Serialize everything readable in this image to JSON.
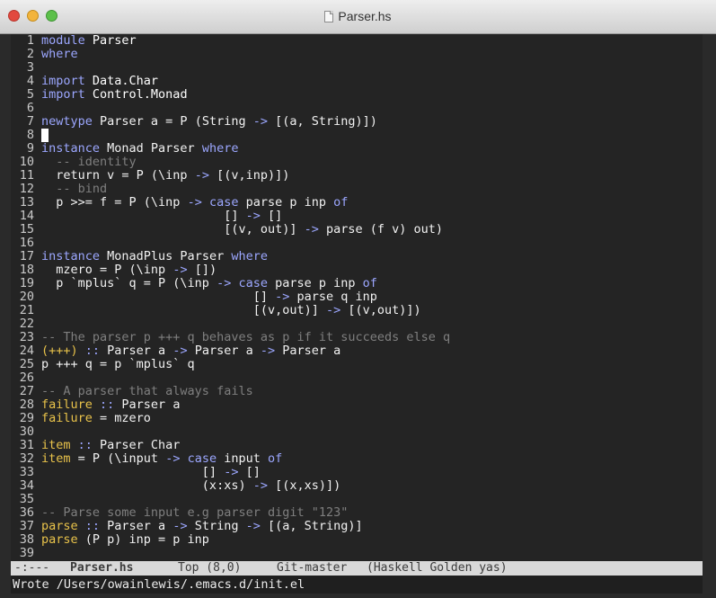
{
  "window": {
    "title": "Parser.hs",
    "file_icon": "document-icon",
    "controls": [
      "close-button",
      "minimize-button",
      "zoom-button"
    ]
  },
  "editor": {
    "lines": [
      {
        "n": "1",
        "segs": [
          {
            "t": "module ",
            "c": "kw"
          },
          {
            "t": "Parser",
            "c": "ty"
          }
        ]
      },
      {
        "n": "2",
        "segs": [
          {
            "t": "where",
            "c": "kw"
          }
        ]
      },
      {
        "n": "3",
        "segs": []
      },
      {
        "n": "4",
        "segs": [
          {
            "t": "import ",
            "c": "kw"
          },
          {
            "t": "Data.Char",
            "c": "ty"
          }
        ]
      },
      {
        "n": "5",
        "segs": [
          {
            "t": "import ",
            "c": "kw"
          },
          {
            "t": "Control.Monad",
            "c": "ty"
          }
        ]
      },
      {
        "n": "6",
        "segs": []
      },
      {
        "n": "7",
        "segs": [
          {
            "t": "newtype ",
            "c": "kw"
          },
          {
            "t": "Parser a = P (String ",
            "c": ""
          },
          {
            "t": "->",
            "c": "kw"
          },
          {
            "t": " [(a, String)])",
            "c": ""
          }
        ]
      },
      {
        "n": "8",
        "segs": [],
        "cursor": true
      },
      {
        "n": "9",
        "segs": [
          {
            "t": "instance ",
            "c": "kw"
          },
          {
            "t": "Monad Parser ",
            "c": ""
          },
          {
            "t": "where",
            "c": "kw"
          }
        ]
      },
      {
        "n": "10",
        "segs": [
          {
            "t": "  -- identity",
            "c": "cm"
          }
        ]
      },
      {
        "n": "11",
        "segs": [
          {
            "t": "  return v = P (\\inp ",
            "c": ""
          },
          {
            "t": "->",
            "c": "kw"
          },
          {
            "t": " [(v,inp)])",
            "c": ""
          }
        ]
      },
      {
        "n": "12",
        "segs": [
          {
            "t": "  -- bind",
            "c": "cm"
          }
        ]
      },
      {
        "n": "13",
        "segs": [
          {
            "t": "  p >>= f = P (\\inp ",
            "c": ""
          },
          {
            "t": "->",
            "c": "kw"
          },
          {
            "t": " ",
            "c": ""
          },
          {
            "t": "case",
            "c": "kw"
          },
          {
            "t": " parse p inp ",
            "c": ""
          },
          {
            "t": "of",
            "c": "kw"
          }
        ]
      },
      {
        "n": "14",
        "segs": [
          {
            "t": "                         [] ",
            "c": ""
          },
          {
            "t": "->",
            "c": "kw"
          },
          {
            "t": " []",
            "c": ""
          }
        ]
      },
      {
        "n": "15",
        "segs": [
          {
            "t": "                         [(v, out)] ",
            "c": ""
          },
          {
            "t": "->",
            "c": "kw"
          },
          {
            "t": " parse (f v) out)",
            "c": ""
          }
        ]
      },
      {
        "n": "16",
        "segs": []
      },
      {
        "n": "17",
        "segs": [
          {
            "t": "instance ",
            "c": "kw"
          },
          {
            "t": "MonadPlus Parser ",
            "c": ""
          },
          {
            "t": "where",
            "c": "kw"
          }
        ]
      },
      {
        "n": "18",
        "segs": [
          {
            "t": "  mzero = P (\\inp ",
            "c": ""
          },
          {
            "t": "->",
            "c": "kw"
          },
          {
            "t": " [])",
            "c": ""
          }
        ]
      },
      {
        "n": "19",
        "segs": [
          {
            "t": "  p `mplus` q = P (\\inp ",
            "c": ""
          },
          {
            "t": "->",
            "c": "kw"
          },
          {
            "t": " ",
            "c": ""
          },
          {
            "t": "case",
            "c": "kw"
          },
          {
            "t": " parse p inp ",
            "c": ""
          },
          {
            "t": "of",
            "c": "kw"
          }
        ]
      },
      {
        "n": "20",
        "segs": [
          {
            "t": "                             [] ",
            "c": ""
          },
          {
            "t": "->",
            "c": "kw"
          },
          {
            "t": " parse q inp",
            "c": ""
          }
        ]
      },
      {
        "n": "21",
        "segs": [
          {
            "t": "                             [(v,out)] ",
            "c": ""
          },
          {
            "t": "->",
            "c": "kw"
          },
          {
            "t": " [(v,out)])",
            "c": ""
          }
        ]
      },
      {
        "n": "22",
        "segs": []
      },
      {
        "n": "23",
        "segs": [
          {
            "t": "-- The parser p +++ q behaves as p if it succeeds else q",
            "c": "cm"
          }
        ]
      },
      {
        "n": "24",
        "segs": [
          {
            "t": "(+++)",
            "c": "fn"
          },
          {
            "t": " :: ",
            "c": "kw"
          },
          {
            "t": "Parser a ",
            "c": ""
          },
          {
            "t": "->",
            "c": "kw"
          },
          {
            "t": " Parser a ",
            "c": ""
          },
          {
            "t": "->",
            "c": "kw"
          },
          {
            "t": " Parser a",
            "c": ""
          }
        ]
      },
      {
        "n": "25",
        "segs": [
          {
            "t": "p +++ q = p `mplus` q",
            "c": ""
          }
        ]
      },
      {
        "n": "26",
        "segs": []
      },
      {
        "n": "27",
        "segs": [
          {
            "t": "-- A parser that always fails",
            "c": "cm"
          }
        ]
      },
      {
        "n": "28",
        "segs": [
          {
            "t": "failure",
            "c": "fn"
          },
          {
            "t": " :: ",
            "c": "kw"
          },
          {
            "t": "Parser a",
            "c": ""
          }
        ]
      },
      {
        "n": "29",
        "segs": [
          {
            "t": "failure",
            "c": "fn"
          },
          {
            "t": " = mzero",
            "c": ""
          }
        ]
      },
      {
        "n": "30",
        "segs": []
      },
      {
        "n": "31",
        "segs": [
          {
            "t": "item",
            "c": "fn"
          },
          {
            "t": " :: ",
            "c": "kw"
          },
          {
            "t": "Parser Char",
            "c": ""
          }
        ]
      },
      {
        "n": "32",
        "segs": [
          {
            "t": "item",
            "c": "fn"
          },
          {
            "t": " = P (\\input ",
            "c": ""
          },
          {
            "t": "->",
            "c": "kw"
          },
          {
            "t": " ",
            "c": ""
          },
          {
            "t": "case",
            "c": "kw"
          },
          {
            "t": " input ",
            "c": ""
          },
          {
            "t": "of",
            "c": "kw"
          }
        ]
      },
      {
        "n": "33",
        "segs": [
          {
            "t": "                      [] ",
            "c": ""
          },
          {
            "t": "->",
            "c": "kw"
          },
          {
            "t": " []",
            "c": ""
          }
        ]
      },
      {
        "n": "34",
        "segs": [
          {
            "t": "                      (x:xs) ",
            "c": ""
          },
          {
            "t": "->",
            "c": "kw"
          },
          {
            "t": " [(x,xs)])",
            "c": ""
          }
        ]
      },
      {
        "n": "35",
        "segs": []
      },
      {
        "n": "36",
        "segs": [
          {
            "t": "-- Parse some input e.g parser digit \"123\"",
            "c": "cm"
          }
        ]
      },
      {
        "n": "37",
        "segs": [
          {
            "t": "parse",
            "c": "fn"
          },
          {
            "t": " :: ",
            "c": "kw"
          },
          {
            "t": "Parser a ",
            "c": ""
          },
          {
            "t": "->",
            "c": "kw"
          },
          {
            "t": " String ",
            "c": ""
          },
          {
            "t": "->",
            "c": "kw"
          },
          {
            "t": " [(a, String)]",
            "c": ""
          }
        ]
      },
      {
        "n": "38",
        "segs": [
          {
            "t": "parse",
            "c": "fn"
          },
          {
            "t": " (P p) inp = p inp",
            "c": ""
          }
        ]
      },
      {
        "n": "39",
        "segs": []
      }
    ]
  },
  "modeline": {
    "status": "-:---",
    "buffer": "Parser.hs",
    "position": "Top (8,0)",
    "vc": "Git-master",
    "modes": "(Haskell Golden yas)"
  },
  "echo_area": {
    "message": "Wrote /Users/owainlewis/.emacs.d/init.el"
  },
  "colors": {
    "background": "#242424",
    "keyword": "#9ca7ff",
    "comment": "#7f7f7f",
    "function_name": "#e8c24a",
    "modeline_bg": "#d9d9d9"
  }
}
